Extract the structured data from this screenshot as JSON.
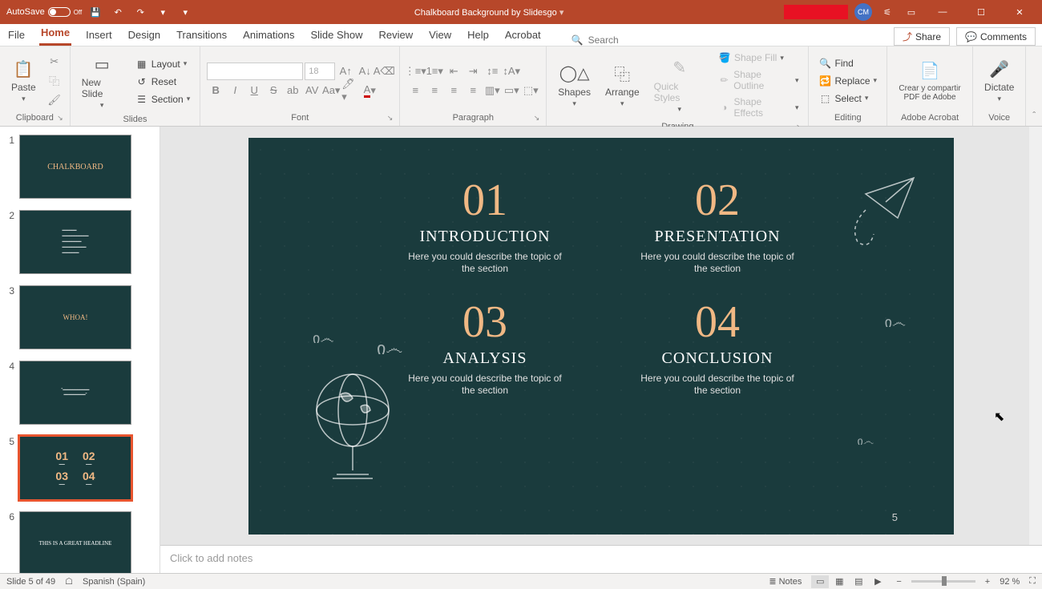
{
  "titlebar": {
    "autosave": "AutoSave",
    "autosave_state": "Off",
    "doc_title": "Chalkboard Background by Slidesgo",
    "user_initials": "CM"
  },
  "tabs": {
    "file": "File",
    "home": "Home",
    "insert": "Insert",
    "design": "Design",
    "transitions": "Transitions",
    "animations": "Animations",
    "slideshow": "Slide Show",
    "review": "Review",
    "view": "View",
    "help": "Help",
    "acrobat": "Acrobat",
    "search": "Search",
    "share": "Share",
    "comments": "Comments"
  },
  "ribbon": {
    "clipboard": {
      "paste": "Paste",
      "label": "Clipboard"
    },
    "slides": {
      "new_slide": "New Slide",
      "layout": "Layout",
      "reset": "Reset",
      "section": "Section",
      "label": "Slides"
    },
    "font": {
      "size": "18",
      "label": "Font"
    },
    "paragraph": {
      "label": "Paragraph"
    },
    "drawing": {
      "shapes": "Shapes",
      "arrange": "Arrange",
      "quick_styles": "Quick Styles",
      "shape_fill": "Shape Fill",
      "shape_outline": "Shape Outline",
      "shape_effects": "Shape Effects",
      "label": "Drawing"
    },
    "editing": {
      "find": "Find",
      "replace": "Replace",
      "select": "Select",
      "label": "Editing"
    },
    "adobe": {
      "create_share": "Crear y compartir PDF de Adobe",
      "label": "Adobe Acrobat"
    },
    "voice": {
      "dictate": "Dictate",
      "label": "Voice"
    }
  },
  "thumbnails": [
    {
      "num": "1",
      "title": "CHALKBOARD"
    },
    {
      "num": "2",
      "title": ""
    },
    {
      "num": "3",
      "title": "WHOA!"
    },
    {
      "num": "4",
      "title": ""
    },
    {
      "num": "5",
      "title": ""
    },
    {
      "num": "6",
      "title": "THIS IS A GREAT HEADLINE"
    }
  ],
  "slide": {
    "items": [
      {
        "num": "01",
        "title": "INTRODUCTION",
        "desc": "Here you could describe the topic of the section"
      },
      {
        "num": "02",
        "title": "PRESENTATION",
        "desc": "Here you could describe the topic of the section"
      },
      {
        "num": "03",
        "title": "ANALYSIS",
        "desc": "Here you could describe the topic of the section"
      },
      {
        "num": "04",
        "title": "CONCLUSION",
        "desc": "Here you could describe the topic of the section"
      }
    ],
    "page_num": "5"
  },
  "notes": {
    "placeholder": "Click to add notes"
  },
  "status": {
    "slide_info": "Slide 5 of 49",
    "language": "Spanish (Spain)",
    "notes_btn": "Notes",
    "zoom": "92 %"
  }
}
